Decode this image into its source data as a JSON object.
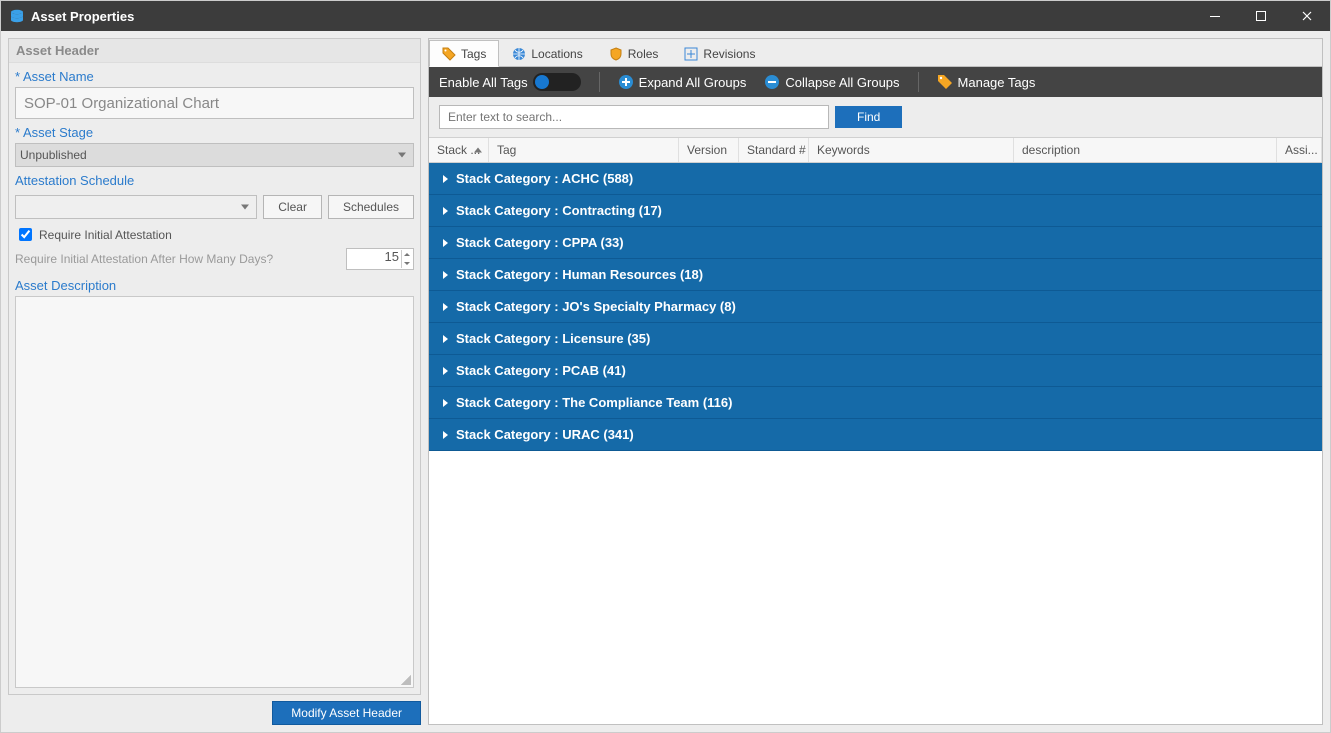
{
  "window": {
    "title": "Asset Properties"
  },
  "left": {
    "header_title": "Asset Header",
    "name_label": "* Asset Name",
    "name_value": "SOP-01 Organizational Chart",
    "stage_label": "* Asset Stage",
    "stage_value": "Unpublished",
    "schedule_label": "Attestation Schedule",
    "clear_btn": "Clear",
    "schedules_btn": "Schedules",
    "require_initial_label": "Require Initial Attestation",
    "require_days_label": "Require Initial Attestation After How Many Days?",
    "require_days_value": "15",
    "description_label": "Asset Description",
    "modify_btn": "Modify Asset Header"
  },
  "tabs": {
    "tags": "Tags",
    "locations": "Locations",
    "roles": "Roles",
    "revisions": "Revisions"
  },
  "toolbar": {
    "enable_all": "Enable All Tags",
    "expand_all": "Expand All Groups",
    "collapse_all": "Collapse All Groups",
    "manage": "Manage Tags"
  },
  "search": {
    "placeholder": "Enter text to search...",
    "find_btn": "Find"
  },
  "columns": {
    "stack": "Stack ...",
    "tag": "Tag",
    "version": "Version",
    "standard": "Standard #",
    "keywords": "Keywords",
    "description": "description",
    "assigned": "Assi..."
  },
  "groups": [
    {
      "label": "Stack Category : ACHC (588)"
    },
    {
      "label": "Stack Category : Contracting (17)"
    },
    {
      "label": "Stack Category : CPPA (33)"
    },
    {
      "label": "Stack Category : Human Resources (18)"
    },
    {
      "label": "Stack Category : JO's Specialty Pharmacy (8)"
    },
    {
      "label": "Stack Category : Licensure (35)"
    },
    {
      "label": "Stack Category : PCAB (41)"
    },
    {
      "label": "Stack Category : The Compliance Team (116)"
    },
    {
      "label": "Stack Category : URAC (341)"
    }
  ]
}
